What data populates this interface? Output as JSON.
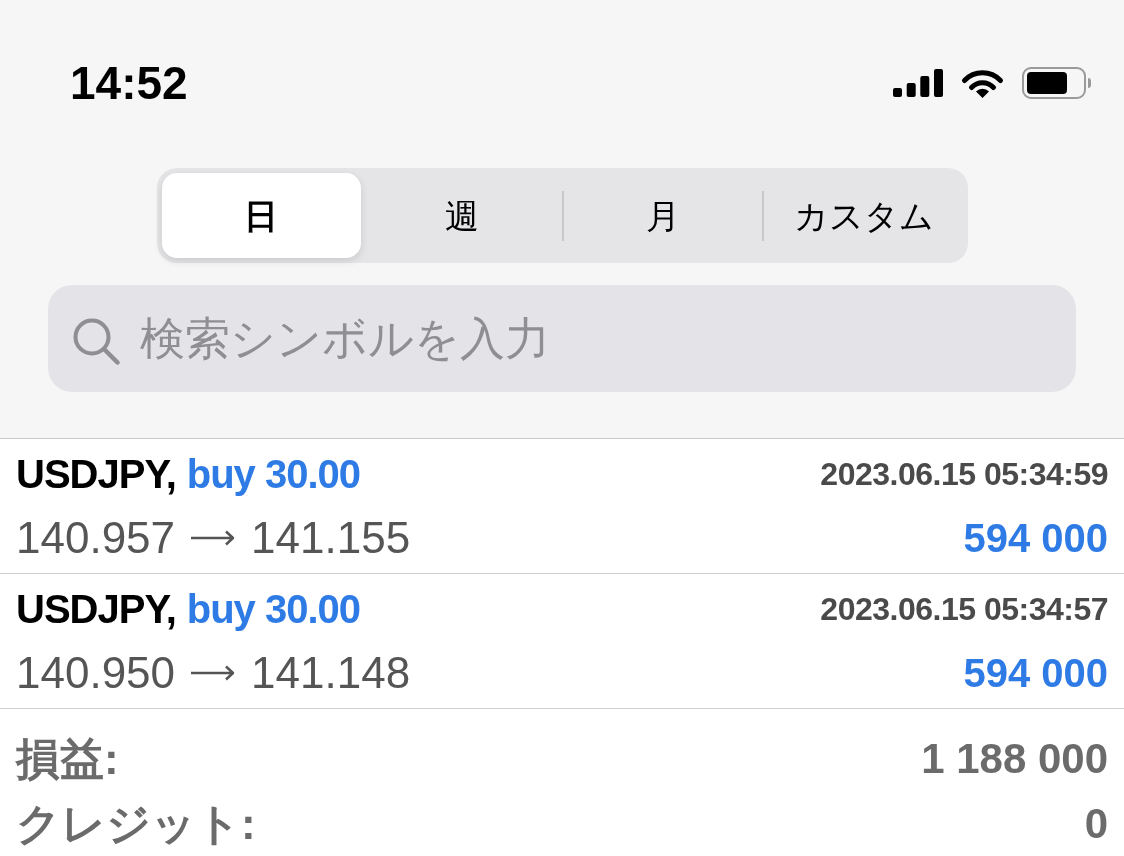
{
  "status_bar": {
    "time": "14:52"
  },
  "period_tabs": [
    {
      "label": "日",
      "selected": true
    },
    {
      "label": "週",
      "selected": false
    },
    {
      "label": "月",
      "selected": false
    },
    {
      "label": "カスタム",
      "selected": false
    }
  ],
  "search": {
    "placeholder": "検索シンボルを入力"
  },
  "deals": [
    {
      "symbol": "USDJPY,",
      "trade": "buy 30.00",
      "time": "2023.06.15 05:34:59",
      "open_price": "140.957",
      "close_price": "141.155",
      "profit": "594 000"
    },
    {
      "symbol": "USDJPY,",
      "trade": "buy 30.00",
      "time": "2023.06.15 05:34:57",
      "open_price": "140.950",
      "close_price": "141.148",
      "profit": "594 000"
    }
  ],
  "summary": [
    {
      "label": "損益:",
      "value": "1 188 000"
    },
    {
      "label": "クレジット:",
      "value": "0"
    }
  ]
}
